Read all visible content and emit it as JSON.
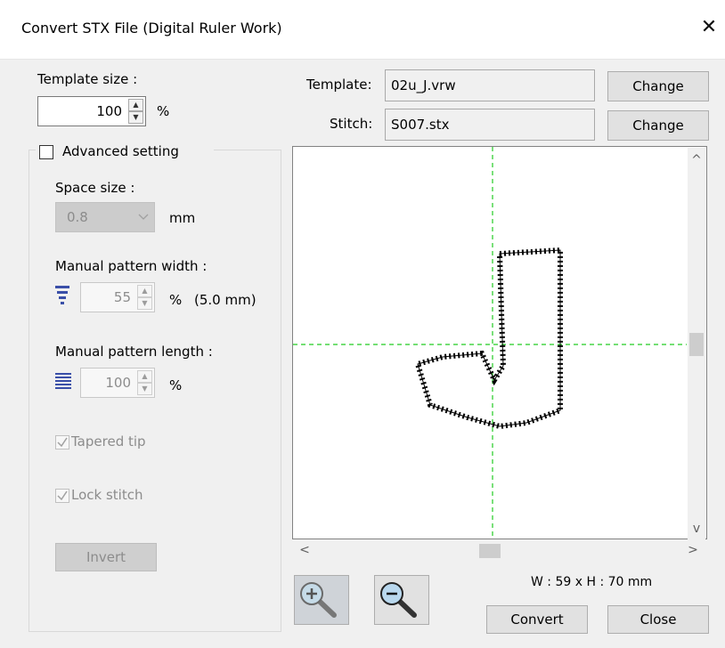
{
  "window": {
    "title": "Convert STX File (Digital Ruler Work)",
    "close_glyph": "✕"
  },
  "template_size": {
    "label": "Template size :",
    "value": "100",
    "unit": "%"
  },
  "advanced": {
    "label": "Advanced setting",
    "checked": false,
    "space_size": {
      "label": "Space size :",
      "value": "0.8",
      "unit": "mm"
    },
    "pattern_width": {
      "label": "Manual pattern width :",
      "value": "55",
      "unit": "%",
      "extra": "(5.0 mm)"
    },
    "pattern_length": {
      "label": "Manual pattern length :",
      "value": "100",
      "unit": "%"
    },
    "tapered_tip": {
      "label": "Tapered tip",
      "checked": true
    },
    "lock_stitch": {
      "label": "Lock stitch",
      "checked": true
    },
    "invert_label": "Invert"
  },
  "template_file": {
    "label": "Template:",
    "value": "02u_J.vrw",
    "change_label": "Change"
  },
  "stitch_file": {
    "label": "Stitch:",
    "value": "S007.stx",
    "change_label": "Change"
  },
  "dimensions": "W :  59 x H :  70 mm",
  "buttons": {
    "convert": "Convert",
    "close": "Close"
  },
  "scroll_glyphs": {
    "up": "^",
    "down": "v",
    "left": "<",
    "right": ">"
  },
  "colors": {
    "crosshair": "#22cc22",
    "selected_zoom_bg": "#cfd3d8"
  }
}
